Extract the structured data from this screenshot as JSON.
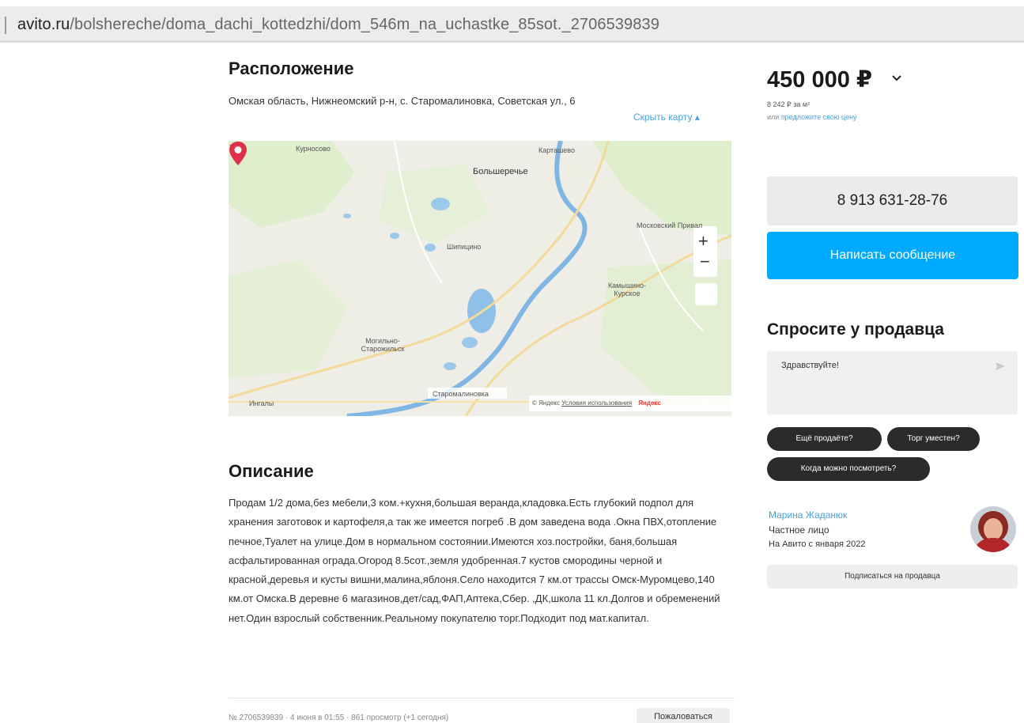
{
  "browser": {
    "url_host": "avito.ru",
    "url_path": "/bolshereche/doma_dachi_kottedzhi/dom_546m_na_uchastke_85sot._2706539839"
  },
  "location": {
    "title": "Расположение",
    "address": "Омская область, Нижнеомский р-н, с. Старомалиновка, Советская ул., 6",
    "hide_map": "Скрыть карту ▴"
  },
  "map": {
    "labels": {
      "kurnosovo": "Курносово",
      "kartashevo": "Карташево",
      "bolsherechye": "Большеречье",
      "shipitsino": "Шипицино",
      "moskovsky": "Московский Привал",
      "kamyshino": "Камышино-Курское",
      "mogilno": "Могильно-Старожильск",
      "starom": "Старомалиновка",
      "ingaly": "Ингалы"
    },
    "zoom_in": "+",
    "zoom_out": "−",
    "copyright": "© Яндекс",
    "terms": "Условия использования",
    "brand": "Яндекс"
  },
  "description": {
    "title": "Описание",
    "text": "Продам 1/2 дома,без мебели,3 ком.+кухня,большая веранда,кладовка.Есть глубокий подпол для хранения заготовок и картофеля,а так же имеется погреб .В дом заведена вода .Окна ПВХ,отопление печное,Туалет на улице.Дом в нормальном состоянии.Имеются хоз.постройки, баня,большая асфальтированная ограда.Огород 8.5сот.,земля удобренная.7 кустов смородины черной и красной,деревья и кусты вишни,малина,яблоня.Село находится 7 км.от трассы Омск-Муромцево,140 км.от Омска.В деревне 6 магазинов,дет/сад,ФАП,Аптека,Сбер. ,ДК,школа 11 кл.Долгов и обременений нет.Один взрослый собственник.Реальному покупателю торг.Подходит под мат.капитал."
  },
  "footer": {
    "meta": "№ 2706539839 · 4 июня в 01:55 · 861 просмотр (+1 сегодня)",
    "report": "Пожаловаться"
  },
  "sidebar": {
    "price": "450 000 ₽",
    "price_per_m": "8 242 ₽ за м²",
    "offer_prefix": "или ",
    "offer_link": "предложите свою цену",
    "phone": "8 913 631-28-76",
    "message_button": "Написать сообщение",
    "ask_title": "Спросите у продавца",
    "ask_placeholder": "Здравствуйте!",
    "chips": [
      "Ещё продаёте?",
      "Торг уместен?",
      "Когда можно посмотреть?"
    ],
    "seller_name": "Марина Жаданюк",
    "seller_type": "Частное лицо",
    "seller_since": "На Авито с января 2022",
    "subscribe": "Подписаться на продавца"
  },
  "colors": {
    "accent_blue": "#00aaff",
    "link_blue": "#4a9fd6",
    "pin_red": "#e0314b",
    "chip_dark": "#2b2b2b"
  }
}
